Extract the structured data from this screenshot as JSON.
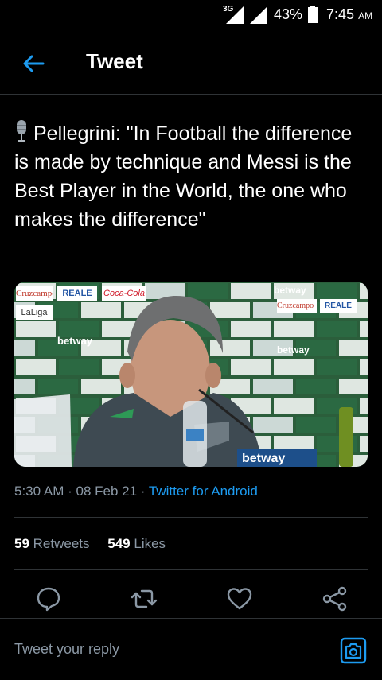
{
  "status_bar": {
    "network": "3G",
    "battery_percent": "43%",
    "time": "7:45",
    "ampm": "AM"
  },
  "header": {
    "title": "Tweet"
  },
  "tweet": {
    "text": "Pellegrini: \"In Football the difference is made by technique and Messi is the Best Player in the World, the one who makes the difference\"",
    "time": "5:30 AM",
    "date": "08 Feb 21",
    "source": "Twitter for Android"
  },
  "stats": {
    "retweets": "59",
    "retweets_label": "Retweets",
    "likes": "549",
    "likes_label": "Likes"
  },
  "reply": {
    "placeholder": "Tweet your reply"
  },
  "media": {
    "board_words": [
      "betway",
      "Cruzcampo",
      "REALE",
      "Coca-Cola",
      "LaLiga"
    ]
  },
  "colors": {
    "accent": "#1d9bf0",
    "muted": "#8b98a5",
    "background": "#000000",
    "divider": "#2f3336"
  }
}
